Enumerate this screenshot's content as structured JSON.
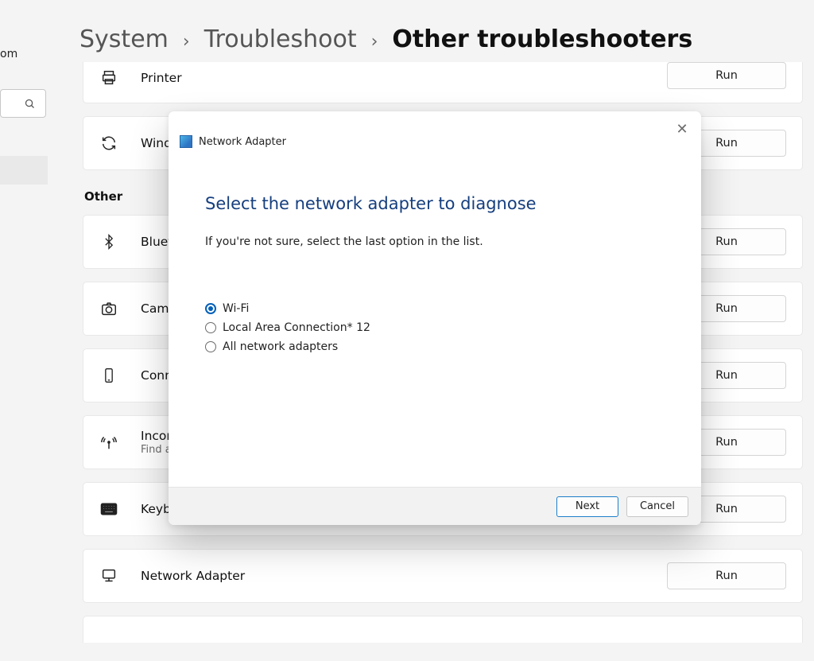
{
  "sidebar": {
    "partial_label": "om",
    "search_icon": "search-icon"
  },
  "breadcrumb": {
    "crumb1": "System",
    "crumb2": "Troubleshoot",
    "current": "Other troubleshooters"
  },
  "section_other_label": "Other",
  "rows": {
    "printer": {
      "title": "Printer",
      "run": "Run"
    },
    "windows_update": {
      "title": "Wind",
      "run": "Run"
    },
    "bluetooth": {
      "title": "Bluet",
      "run": "Run"
    },
    "camera": {
      "title": "Came",
      "run": "Run"
    },
    "connected_devices": {
      "title": "Conn",
      "run": "Run"
    },
    "incoming": {
      "title": "Incon",
      "sub": "Find a",
      "run": "Run"
    },
    "keyboard": {
      "title": "Keyboard",
      "run": "Run"
    },
    "network_adapter": {
      "title": "Network Adapter",
      "run": "Run"
    }
  },
  "dialog": {
    "title": "Network Adapter",
    "heading": "Select the network adapter to diagnose",
    "text": "If you're not sure, select the last option in the list.",
    "options": {
      "wifi": "Wi-Fi",
      "lac12": "Local Area Connection* 12",
      "all": "All network adapters"
    },
    "selected": "wifi",
    "next": "Next",
    "cancel": "Cancel"
  }
}
